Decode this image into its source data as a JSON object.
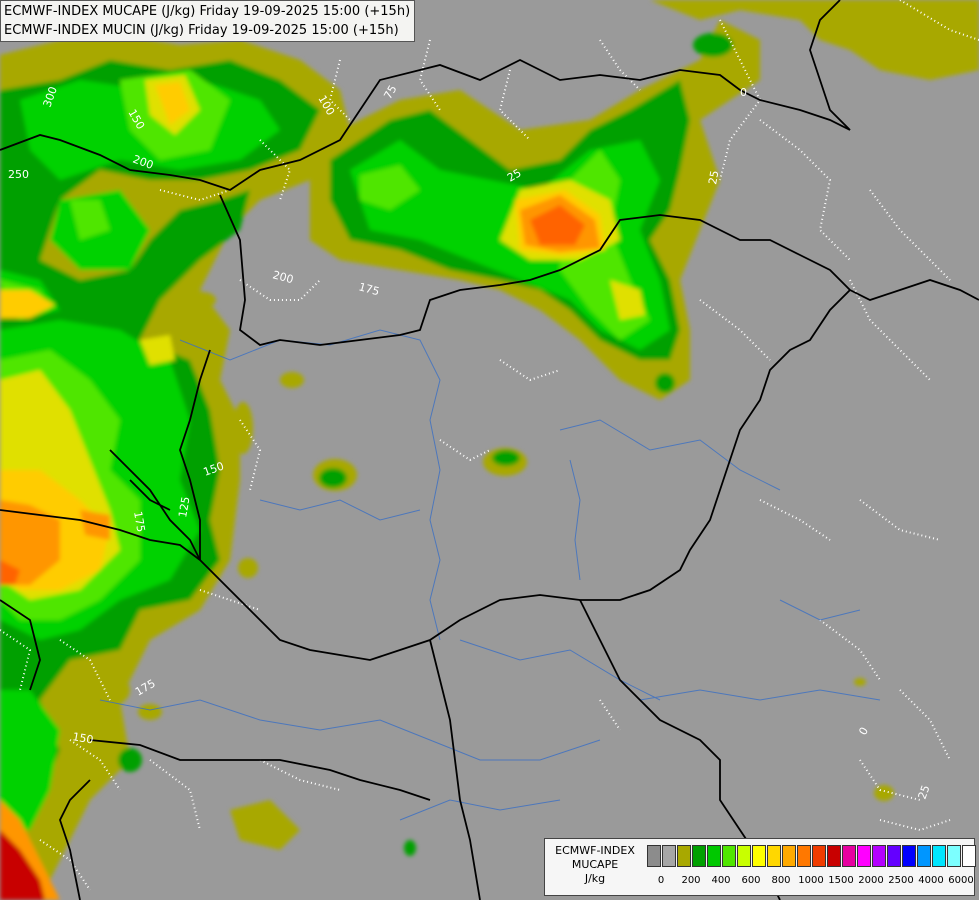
{
  "title": {
    "line1": "ECMWF-INDEX MUCAPE (J/kg) Friday 19-09-2025 15:00 (+15h)",
    "line2": "ECMWF-INDEX MUCIN (J/kg) Friday 19-09-2025 15:00 (+15h)"
  },
  "legend": {
    "model": "ECMWF-INDEX",
    "param": "MUCAPE",
    "unit": "J/kg",
    "colors": [
      "#8c8c8c",
      "#a6a6a6",
      "#a8a800",
      "#00a000",
      "#00c800",
      "#50e600",
      "#c8ff00",
      "#ffff00",
      "#ffd700",
      "#ffaa00",
      "#ff7800",
      "#f03c00",
      "#c80000",
      "#e600a0",
      "#ff00ff",
      "#b400ff",
      "#6400ff",
      "#0000ff",
      "#0096ff",
      "#00e6ff",
      "#7cffff",
      "#ffffff"
    ],
    "tick_labels": [
      "0",
      "200",
      "400",
      "600",
      "800",
      "1000",
      "1500",
      "2000",
      "2500",
      "4000",
      "6000"
    ]
  },
  "contour_labels": [
    "300",
    "150",
    "200",
    "100",
    "75",
    "250",
    "25",
    "0",
    "200",
    "175",
    "25",
    "150",
    "175",
    "125",
    "175",
    "150",
    "0",
    "25"
  ]
}
